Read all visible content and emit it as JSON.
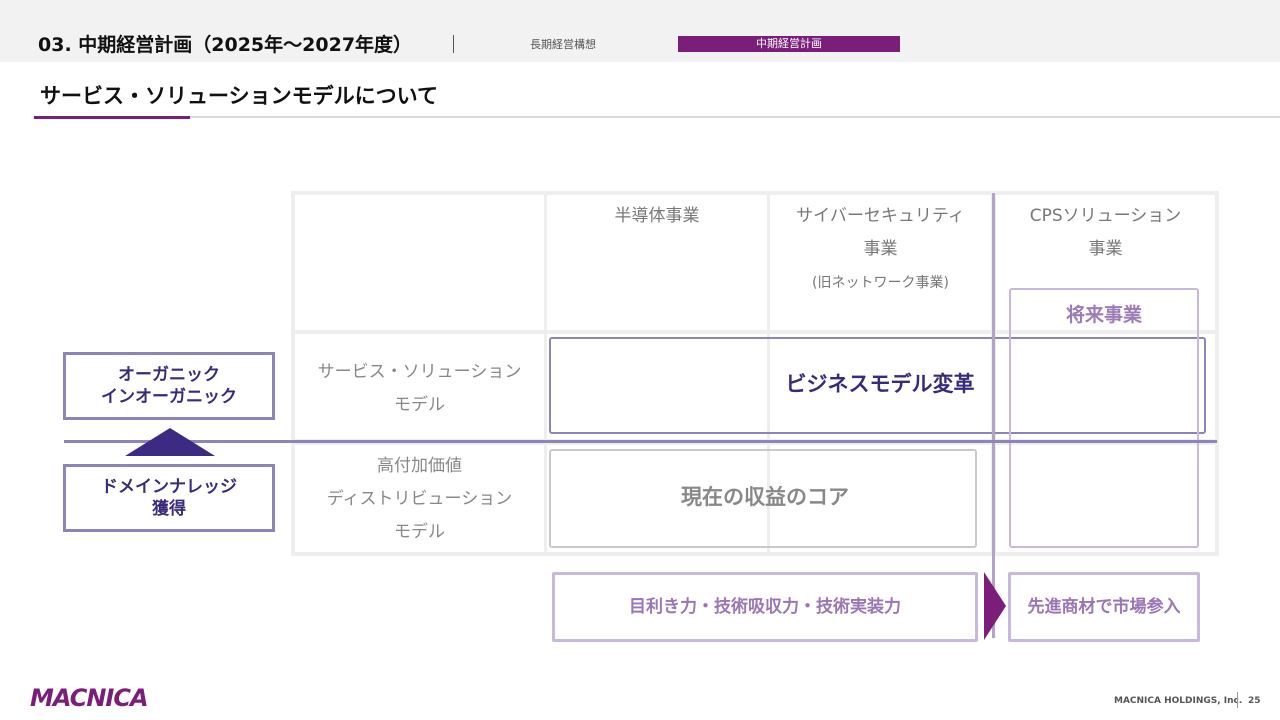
{
  "header": {
    "section_title": "03. 中期経営計画（2025年〜2027年度）",
    "tab_inactive": "長期経営構想",
    "tab_active": "中期経営計画"
  },
  "page_title": "サービス・ソリューションモデルについて",
  "matrix": {
    "col1": "半導体事業",
    "col2_line1": "サイバーセキュリティ",
    "col2_line2": "事業",
    "col2_sub": "(旧ネットワーク事業)",
    "col3_line1": "CPSソリューション",
    "col3_line2": "事業",
    "row1_line1": "サービス・ソリューション",
    "row1_line2": "モデル",
    "row2_line1": "高付加価値",
    "row2_line2": "ディストリビューション",
    "row2_line3": "モデル",
    "biz_model_change": "ビジネスモデル変革",
    "current_core": "現在の収益のコア",
    "future_business": "将来事業"
  },
  "side": {
    "organic_line1": "オーガニック",
    "organic_line2": "インオーガニック",
    "domain_line1": "ドメインナレッジ",
    "domain_line2": "獲得"
  },
  "capabilities": {
    "left": "目利き力・技術吸収力・技術実装力",
    "right": "先進商材で市場参入"
  },
  "footer": {
    "logo": "MACNICA",
    "company": "MACNICA HOLDINGS, Inc.",
    "page": "25"
  },
  "colors": {
    "brand_purple": "#7b1e7a",
    "accent_indigo": "#3a2a7a",
    "border_lavender": "#8e84b8"
  }
}
